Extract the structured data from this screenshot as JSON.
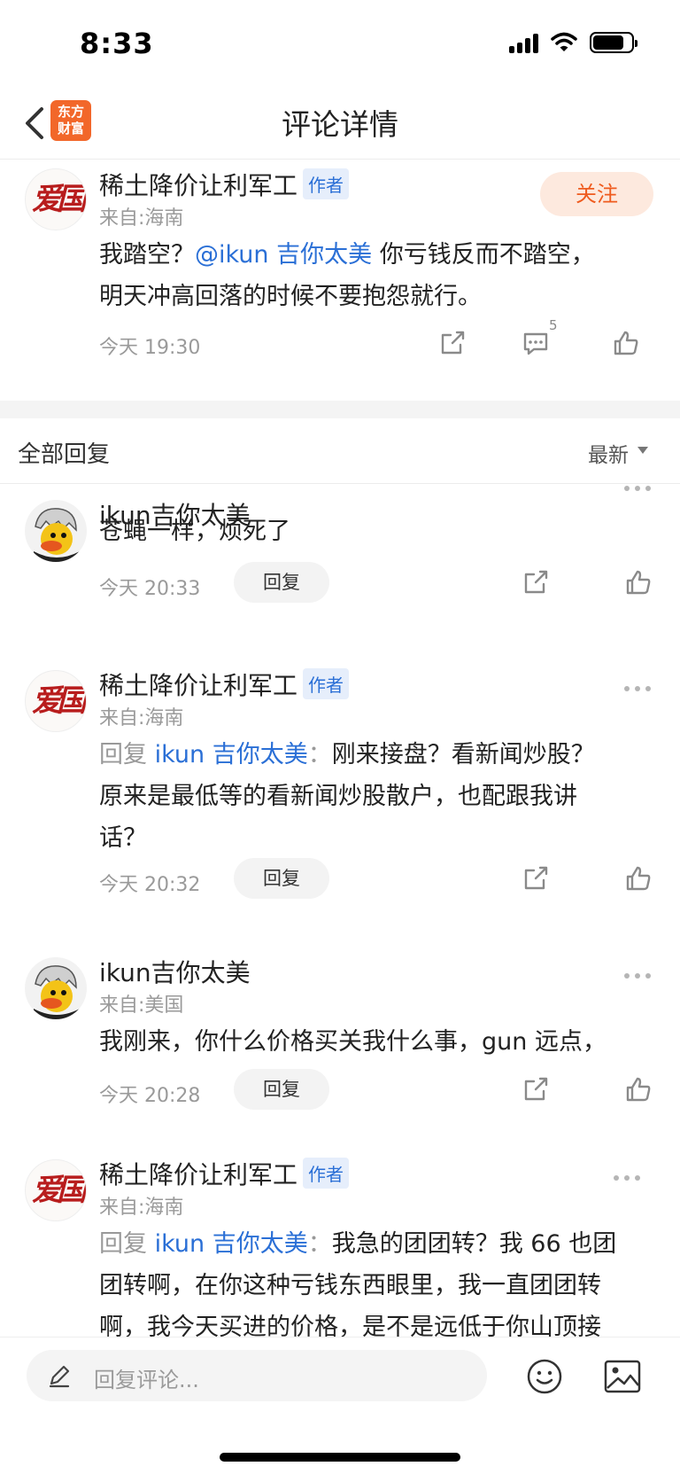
{
  "status_bar": {
    "time": "8:33"
  },
  "nav": {
    "title": "评论详情",
    "logo_line1": "东方",
    "logo_line2": "财富"
  },
  "post": {
    "author": "稀土降价让利军工",
    "badge": "作者",
    "from": "来自:海南",
    "follow_label": "关注",
    "text_before": "我踏空？",
    "mention": "@ikun 吉你太美",
    "text_after": " 你亏钱反而不踏空，",
    "text_line2": "明天冲高回落的时候不要抱怨就行。",
    "time": "今天 19:30",
    "comment_count": "5"
  },
  "replies_header": {
    "label": "全部回复",
    "sort": "最新"
  },
  "comments": [
    {
      "author": "ikun吉你太美",
      "text_line1": "苍蝇一样，烦死了",
      "time": "今天 20:33",
      "reply_label": "回复"
    },
    {
      "author": "稀土降价让利军工",
      "badge": "作者",
      "from": "来自:海南",
      "prefix": "回复",
      "mention": "ikun 吉你太美",
      "colon": "：",
      "text_line1": "刚来接盘？看新闻炒股？",
      "text_line2": "原来是最低等的看新闻炒股散户，也配跟我讲",
      "text_line3": "话？",
      "time": "今天 20:32",
      "reply_label": "回复"
    },
    {
      "author": "ikun吉你太美",
      "from": "来自:美国",
      "text_line1": "我刚来，你什么价格买关我什么事，gun 远点，",
      "time": "今天 20:28",
      "reply_label": "回复"
    },
    {
      "author": "稀土降价让利军工",
      "badge": "作者",
      "from": "来自:海南",
      "prefix": "回复",
      "mention": "ikun 吉你太美",
      "colon": "：",
      "text_line1": "我急的团团转？我 66 也团",
      "text_line2": "团转啊，在你这种亏钱东西眼里，我一直团团转",
      "text_line3": "啊，我今天买进的价格，是不是远低于你山顶接"
    }
  ],
  "bottom_bar": {
    "input_placeholder": "回复评论..."
  },
  "avatar_text": "爱国",
  "colors": {
    "accent_orange": "#f2672a",
    "link_blue": "#2a6fd6",
    "follow_text": "#ef5b1e"
  }
}
